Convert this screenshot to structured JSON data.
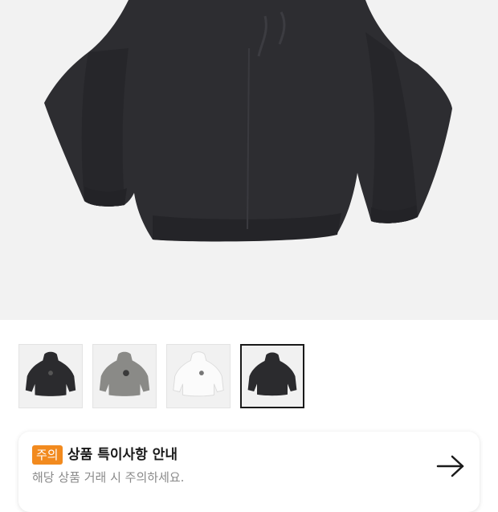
{
  "product": {
    "main_image": "black-hoodie-photo",
    "thumbnails": [
      {
        "name": "black-hoodie",
        "color": "#2b2b2e",
        "selected": false
      },
      {
        "name": "gray-hoodie",
        "color": "#8a8a87",
        "selected": false
      },
      {
        "name": "white-hoodie",
        "color": "#f4f4f4",
        "selected": false
      },
      {
        "name": "black-hoodie",
        "color": "#2b2b2e",
        "selected": true
      }
    ]
  },
  "notice": {
    "badge": "주의",
    "title": "상품 특이사항 안내",
    "subtitle": "해당 상품 거래 시 주의하세요.",
    "arrow_icon": "arrow-right-icon"
  },
  "colors": {
    "badge_bg": "#f28a1e",
    "hero_bg": "#f2f2f2"
  }
}
